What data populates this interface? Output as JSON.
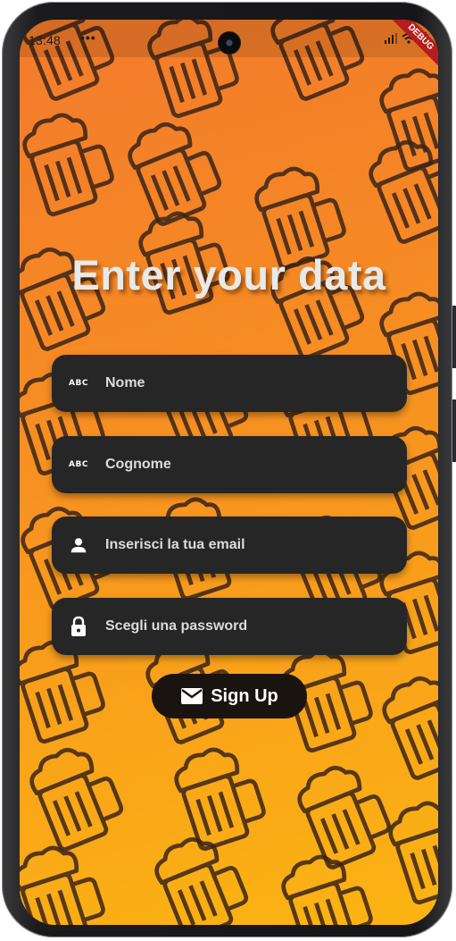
{
  "status": {
    "time": "13:48",
    "dots": "•••",
    "banner": "DEBUG"
  },
  "title": "Enter your data",
  "fields": [
    {
      "label": "Nome",
      "icon": "text-fields-icon",
      "icon_text": "ABC"
    },
    {
      "label": "Cognome",
      "icon": "text-fields-icon",
      "icon_text": "ABC"
    },
    {
      "label": "Inserisci la tua email",
      "icon": "person-icon"
    },
    {
      "label": "Scegli una password",
      "icon": "lock-icon"
    }
  ],
  "signup": {
    "label": "Sign Up",
    "icon": "mail-icon"
  },
  "colors": {
    "background_top": "#f37a2c",
    "background_bottom": "#fbb412",
    "field_bg": "#262626",
    "button_bg": "#1a1410",
    "title": "#e9e9e9",
    "pattern": "#3a2418"
  }
}
